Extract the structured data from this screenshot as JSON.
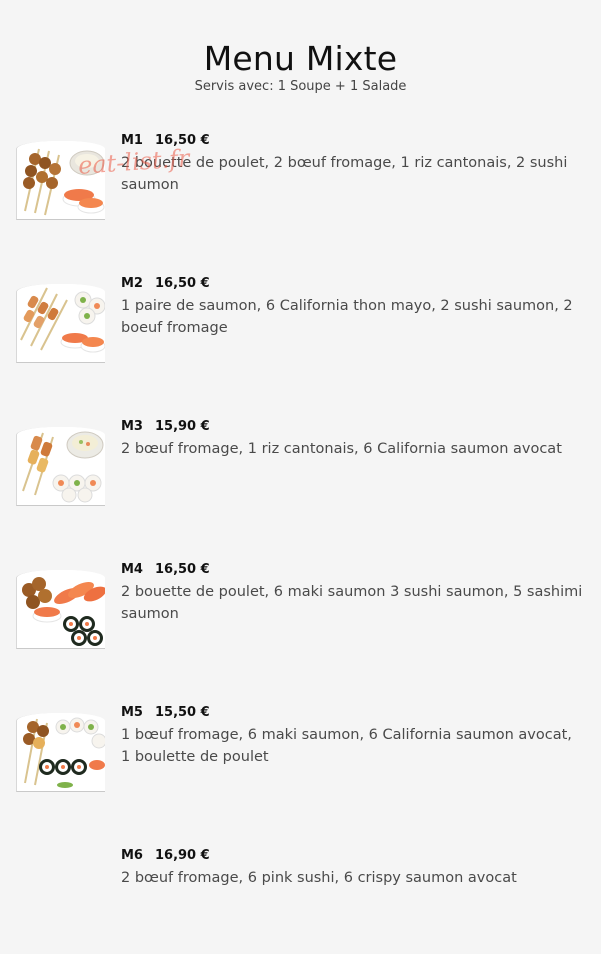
{
  "menu": {
    "title": "Menu Mixte",
    "subtitle": "Servis avec: 1 Soupe + 1 Salade"
  },
  "watermark": "eat-list.fr",
  "items": [
    {
      "code": "M1",
      "price": "16,50 €",
      "description": "2 bouette de poulet, 2 bœuf fromage, 1 riz cantonais, 2 sushi saumon",
      "has_image": true
    },
    {
      "code": "M2",
      "price": "16,50 €",
      "description": "1 paire de saumon, 6 California thon mayo, 2 sushi saumon, 2 boeuf fromage",
      "has_image": true
    },
    {
      "code": "M3",
      "price": "15,90 €",
      "description": "2 bœuf fromage, 1 riz cantonais, 6 California saumon avocat",
      "has_image": true
    },
    {
      "code": "M4",
      "price": "16,50 €",
      "description": "2 bouette de poulet, 6 maki saumon 3 sushi saumon, 5 sashimi saumon",
      "has_image": true
    },
    {
      "code": "M5",
      "price": "15,50 €",
      "description": "1 bœuf fromage, 6 maki saumon, 6 California saumon avocat, 1 boulette de poulet",
      "has_image": true
    },
    {
      "code": "M6",
      "price": "16,90 €",
      "description": "2 bœuf fromage, 6 pink sushi, 6 crispy saumon avocat",
      "has_image": false
    }
  ],
  "colors": {
    "background": "#f5f5f5",
    "salmon": "#f07a4a",
    "skewer_meat": "#a5652b",
    "watermark": "#eb5a46"
  }
}
